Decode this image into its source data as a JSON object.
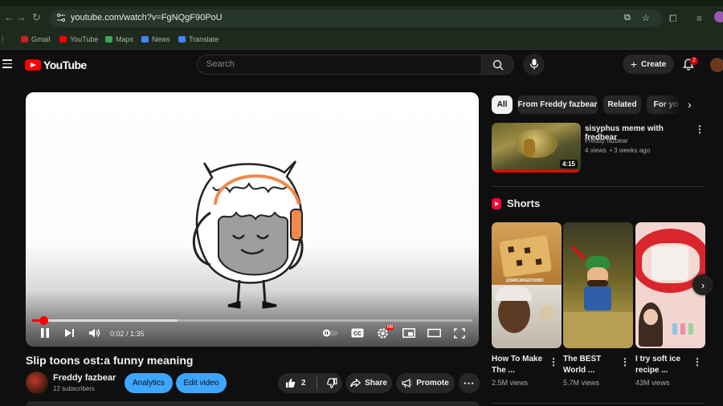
{
  "browser": {
    "url": "youtube.com/watch?v=FgNQgF90PoU",
    "bookmarks": [
      {
        "label": "Gmail",
        "icon": "gmail-icon",
        "color": "#c5221f"
      },
      {
        "label": "YouTube",
        "icon": "youtube-icon",
        "color": "#ff0000"
      },
      {
        "label": "Maps",
        "icon": "maps-icon",
        "color": "#34a853"
      },
      {
        "label": "News",
        "icon": "news-icon",
        "color": "#4285f4"
      },
      {
        "label": "Translate",
        "icon": "translate-icon",
        "color": "#4285f4"
      }
    ]
  },
  "header": {
    "logo_text": "YouTube",
    "search_placeholder": "Search",
    "create_label": "Create",
    "notification_count": "2"
  },
  "player": {
    "time": "0:02 / 1:35",
    "progress_fraction": 0.025,
    "buffered_fraction": 0.33,
    "hd_badge": "HD"
  },
  "video": {
    "title": "Slip toons ost:a funny meaning",
    "channel": "Freddy fazbear",
    "subscribers": "12 subscribers",
    "analytics_label": "Analytics",
    "edit_label": "Edit video",
    "like_count": "2",
    "share_label": "Share",
    "promote_label": "Promote"
  },
  "chips": [
    "All",
    "From Freddy fazbear",
    "Related",
    "For you"
  ],
  "recommendation": {
    "title": "sisyphus meme with fredbear",
    "channel": "Freddy fazbear",
    "meta": "4 views  • 3 weeks ago",
    "duration": "4:15"
  },
  "shorts": {
    "heading": "Shorts",
    "items": [
      {
        "title": "How To Make The ...",
        "views": "2.5M views",
        "overlay": "@SIRCAKESTUDIO"
      },
      {
        "title": "The BEST World ...",
        "views": "5.7M views"
      },
      {
        "title": "I try soft ice recipe ...",
        "views": "43M views"
      }
    ]
  },
  "colors": {
    "accent_red": "#ff0000",
    "accent_blue": "#3ea6ff",
    "background": "#0f0f0f",
    "headphones": "#f08a4b"
  }
}
